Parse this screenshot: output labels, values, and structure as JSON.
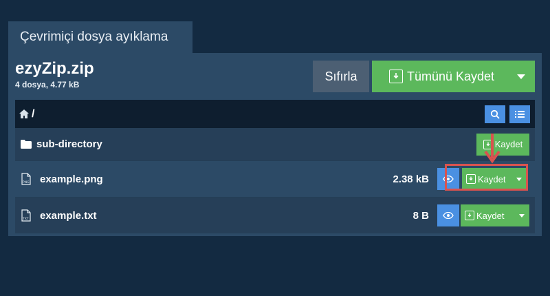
{
  "tab": {
    "label": "Çevrimiçi dosya ayıklama"
  },
  "archive": {
    "name": "ezyZip.zip",
    "meta": "4 dosya, 4.77 kB"
  },
  "toolbar": {
    "reset_label": "Sıfırla",
    "save_all_label": "Tümünü Kaydet"
  },
  "path": {
    "current": "/"
  },
  "rows": [
    {
      "type": "folder",
      "name": "sub-directory",
      "save_label": "Kaydet"
    },
    {
      "type": "file",
      "icon_text": "PNG",
      "name": "example.png",
      "size": "2.38 kB",
      "save_label": "Kaydet"
    },
    {
      "type": "file",
      "icon_text": "TXT",
      "name": "example.txt",
      "size": "8 B",
      "save_label": "Kaydet"
    }
  ],
  "colors": {
    "background": "#132a41",
    "panel": "#2c4a66",
    "primary_green": "#5cb85c",
    "info_blue": "#4a90e2",
    "highlight_red": "#d9534f"
  }
}
